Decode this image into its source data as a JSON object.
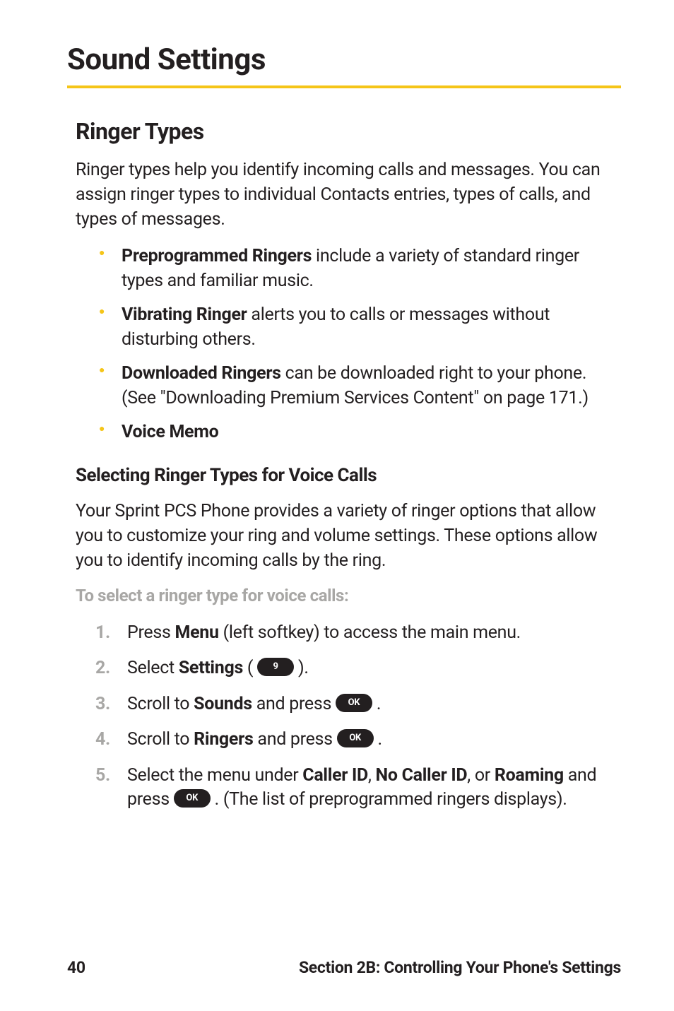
{
  "title": "Sound Settings",
  "section_heading": "Ringer Types",
  "intro": "Ringer types help you identify incoming calls and messages. You can assign ringer types to individual Contacts entries, types of calls, and types of messages.",
  "bullets": [
    {
      "bold": "Preprogrammed Ringers",
      "rest": " include a variety of standard ringer types and familiar music."
    },
    {
      "bold": "Vibrating Ringer",
      "rest": " alerts you to calls or messages without disturbing others."
    },
    {
      "bold": "Downloaded Ringers",
      "rest": " can be downloaded right to your phone. (See \"Downloading Premium Services Content\" on page 171.)"
    },
    {
      "bold": "Voice Memo",
      "rest": ""
    }
  ],
  "sub_heading": "Selecting Ringer Types for Voice Calls",
  "sub_intro": "Your Sprint PCS Phone provides a variety of ringer options that allow you to customize your ring and volume settings. These options allow you to identify incoming calls by the ring.",
  "instruction_label": "To select a ringer type for voice calls:",
  "steps": [
    {
      "num": "1.",
      "pre": "Press ",
      "bold1": "Menu",
      "mid": " (left softkey) to access the main menu.",
      "key": "",
      "post": ""
    },
    {
      "num": "2.",
      "pre": "Select ",
      "bold1": "Settings",
      "mid": " ( ",
      "key": "9",
      "post": " )."
    },
    {
      "num": "3.",
      "pre": "Scroll to ",
      "bold1": "Sounds",
      "mid": " and press ",
      "key": "OK",
      "post": " ."
    },
    {
      "num": "4.",
      "pre": "Scroll to ",
      "bold1": "Ringers",
      "mid": " and press ",
      "key": "OK",
      "post": " ."
    }
  ],
  "step5": {
    "num": "5.",
    "pre": "Select the menu under ",
    "b1": "Caller ID",
    "sep1": ", ",
    "b2": "No Caller ID",
    "sep2": ", or ",
    "b3": "Roaming",
    "mid": " and press ",
    "key": "OK",
    "post": " . (The list of preprogrammed ringers displays)."
  },
  "footer": {
    "page": "40",
    "section": "Section 2B: Controlling Your Phone's Settings"
  }
}
